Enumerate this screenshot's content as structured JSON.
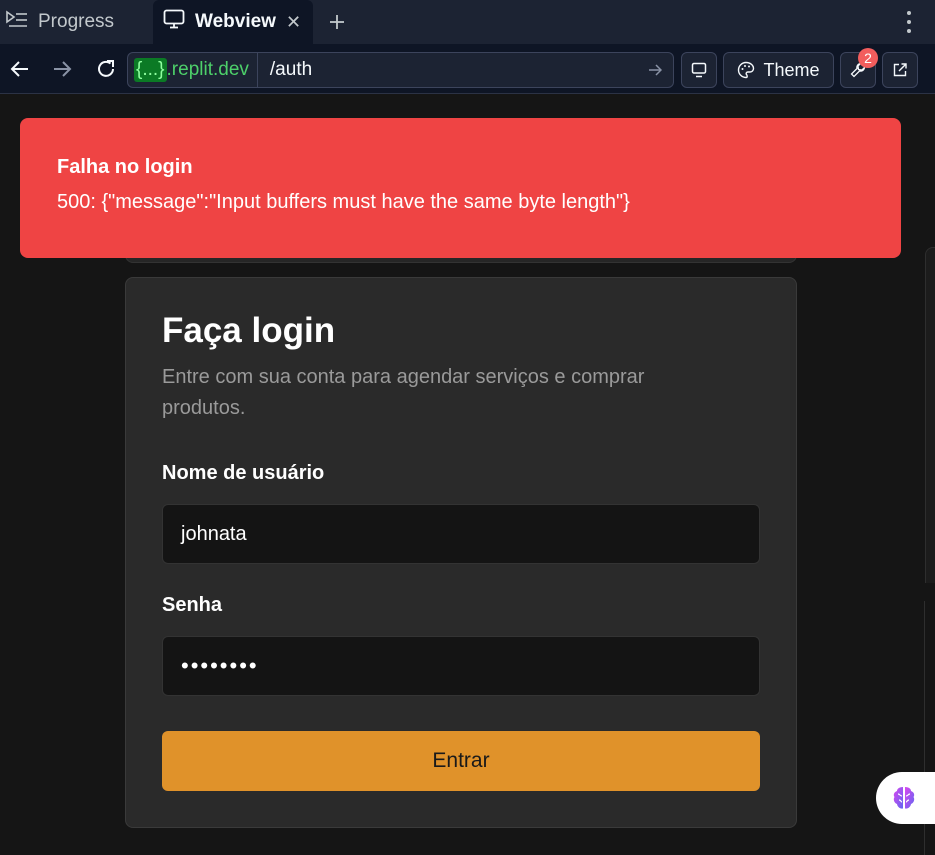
{
  "tabs": [
    {
      "label": "Progress",
      "icon": "progress-list-icon"
    },
    {
      "label": "Webview",
      "icon": "monitor-icon",
      "active": true
    }
  ],
  "address_bar": {
    "host_highlight": "{...}",
    "host_suffix": ".replit.dev",
    "path": "/auth"
  },
  "toolbar": {
    "theme_label": "Theme",
    "devtools_badge": "2"
  },
  "toast": {
    "title": "Falha no login",
    "description": "500: {\"message\":\"Input buffers must have the same byte length\"}"
  },
  "login": {
    "title": "Faça login",
    "subtitle": "Entre com sua conta para agendar serviços e comprar produtos.",
    "username_label": "Nome de usuário",
    "username_value": "johnata",
    "password_label": "Senha",
    "password_value": "••••••••",
    "submit_label": "Entrar"
  },
  "colors": {
    "toast_bg": "#ef4444",
    "submit_bg": "#e0922a",
    "tabbar_bg": "#1c2333",
    "host_green": "#4dd06a"
  }
}
